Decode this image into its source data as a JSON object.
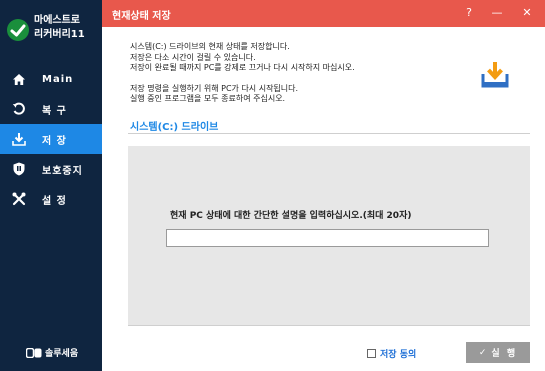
{
  "app": {
    "name_line1": "마에스트로",
    "name_line2": "리커버리11"
  },
  "sidebar": {
    "items": [
      {
        "label": "Main",
        "icon": "home-icon",
        "active": false
      },
      {
        "label": "복 구",
        "icon": "restore-icon",
        "active": false
      },
      {
        "label": "저 장",
        "icon": "save-icon",
        "active": true
      },
      {
        "label": "보호중지",
        "icon": "shield-icon",
        "active": false
      },
      {
        "label": "설 정",
        "icon": "tools-icon",
        "active": false
      }
    ],
    "footer": "솔루세움"
  },
  "titlebar": {
    "title": "현재상태 저장",
    "help": "?",
    "minimize": "—",
    "close": "✕"
  },
  "description": {
    "line1": "시스템(C:) 드라이브의 현재 상태를 저장합니다.",
    "line2": "저장은 다소 시간이 걸릴 수 있습니다.",
    "line3": "저장이 완료될 때까지 PC를 강제로 끄거나 다시 시작하지 마십시오.",
    "line4": "저장 명령을 실행하기 위해 PC가 다시 시작됩니다.",
    "line5": "실행 중인 프로그램을 모두 종료하여 주십시오."
  },
  "section": {
    "title": "시스템(C:) 드라이브"
  },
  "form": {
    "prompt": "현재 PC 상태에 대한 간단한 설명을 입력하십시오.(최대 20자)",
    "value": ""
  },
  "footer": {
    "agree_label": "저장 동의",
    "run_check": "✓",
    "run_label": "실 행"
  },
  "colors": {
    "sidebar_bg": "#0f2540",
    "accent_blue": "#1e88e5",
    "titlebar_red": "#e8584c",
    "panel_gray": "#e7e7e7",
    "run_button_gray": "#9a9a9a"
  }
}
